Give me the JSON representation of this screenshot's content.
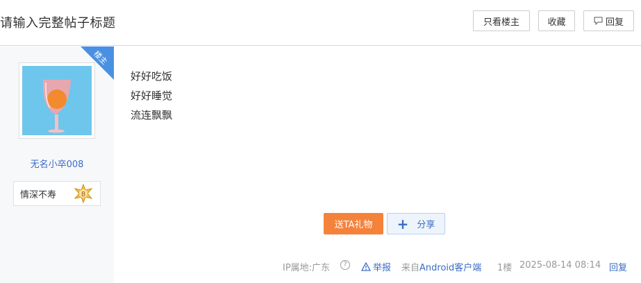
{
  "header": {
    "title": "请输入完整帖子标题",
    "only_louzhu_label": "只看楼主",
    "collect_label": "收藏",
    "reply_label": "回复"
  },
  "sidebar": {
    "corner_label": "楼主",
    "username": "无名小卒008",
    "badge_text": "情深不寿",
    "badge_level": "8"
  },
  "post": {
    "lines": [
      "好好吃饭",
      "好好睡觉",
      "流连飘飘"
    ]
  },
  "actions": {
    "gift_label": "送TA礼物",
    "share_label": "分享"
  },
  "footer": {
    "ip_label": "IP属地:广东",
    "report_label": "举报",
    "from_prefix": "来自",
    "from_client": "Android客户端",
    "floor": "1楼",
    "datetime": "2025-08-14 08:14",
    "reply_label": "回复"
  },
  "colors": {
    "accent_blue": "#3a6bc4",
    "corner_blue": "#4a90e2",
    "gift_orange": "#f5823b"
  }
}
